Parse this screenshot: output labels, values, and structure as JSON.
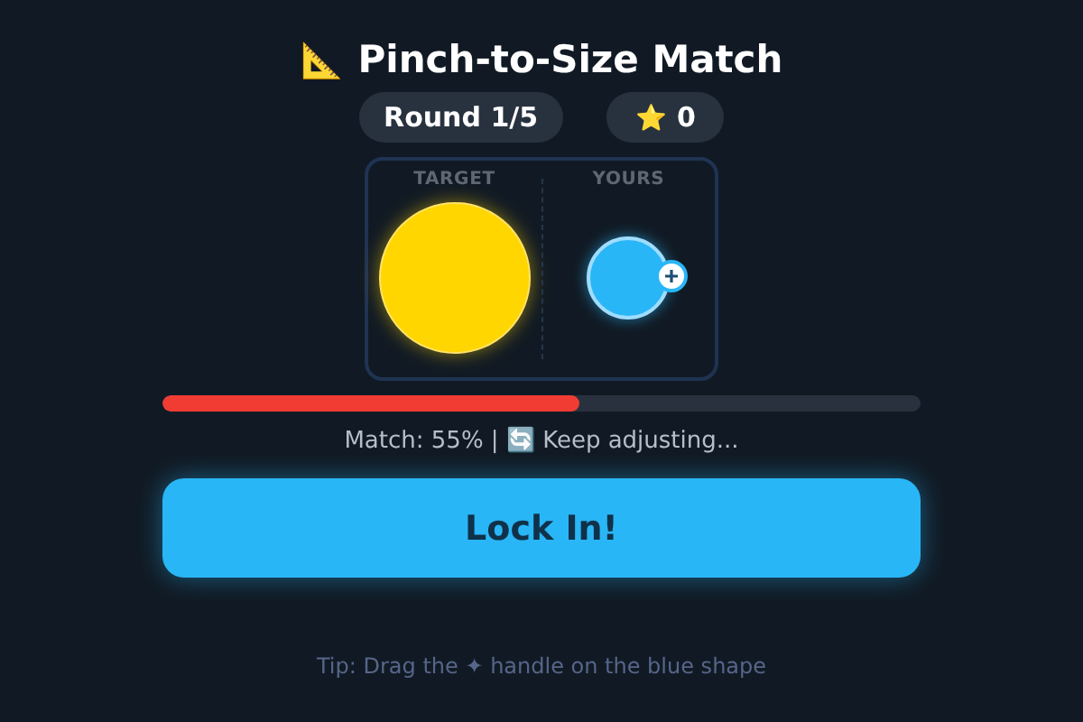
{
  "title": {
    "icon": "📐",
    "text": "Pinch-to-Size Match"
  },
  "badges": [
    {
      "kind": "round",
      "text": "Round 1/5"
    },
    {
      "kind": "score",
      "icon": "⭐",
      "text": "0"
    }
  ],
  "panel": {
    "columns": [
      {
        "label": "TARGET",
        "kind": "target"
      },
      {
        "label": "YOURS",
        "kind": "yours"
      }
    ]
  },
  "match": {
    "level": 0.55,
    "status": "Match: 55% | 🔄 Keep adjusting..."
  },
  "button": "Lock In!",
  "tip": "Tip: Drag the ✦ handle on the blue shape"
}
